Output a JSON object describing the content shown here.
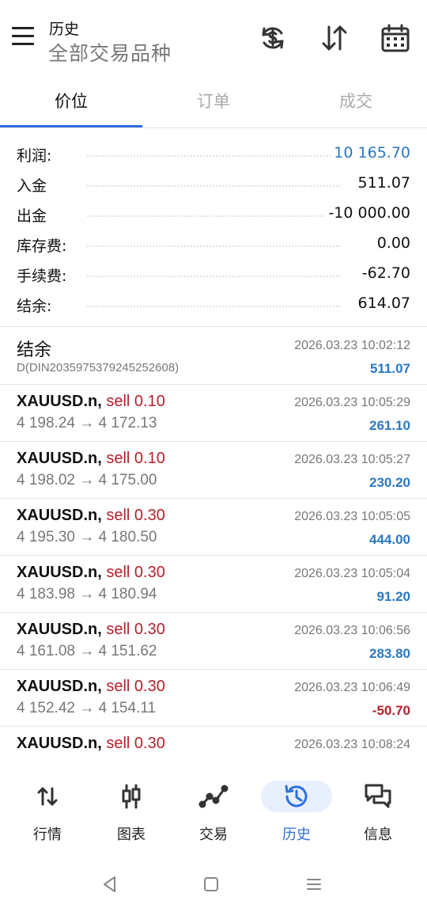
{
  "header": {
    "title": "历史",
    "subtitle": "全部交易品种",
    "icons": [
      "currency-exchange-icon",
      "sort-icon",
      "calendar-icon"
    ]
  },
  "tabs": [
    {
      "label": "价位",
      "active": true
    },
    {
      "label": "订单",
      "active": false
    },
    {
      "label": "成交",
      "active": false
    }
  ],
  "summary": [
    {
      "label": "利润:",
      "value": "10 165.70",
      "color": "#2a78c4"
    },
    {
      "label": "入金",
      "value": "511.07"
    },
    {
      "label": "出金",
      "value": "-10 000.00"
    },
    {
      "label": "库存费:",
      "value": "0.00"
    },
    {
      "label": "手续费:",
      "value": "-62.70"
    },
    {
      "label": "结余:",
      "value": "614.07"
    }
  ],
  "balance_entry": {
    "title": "结余",
    "comment": "D(DIN2035975379245252608)",
    "time": "2026.03.23 10:02:12",
    "amount": "511.07"
  },
  "deals": [
    {
      "symbol": "XAUUSD.n,",
      "type": "sell 0.10",
      "prices": "4 198.24 → 4 172.13",
      "time": "2026.03.23 10:05:29",
      "profit": "261.10"
    },
    {
      "symbol": "XAUUSD.n,",
      "type": "sell 0.10",
      "prices": "4 198.02 → 4 175.00",
      "time": "2026.03.23 10:05:27",
      "profit": "230.20"
    },
    {
      "symbol": "XAUUSD.n,",
      "type": "sell 0.30",
      "prices": "4 195.30 → 4 180.50",
      "time": "2026.03.23 10:05:05",
      "profit": "444.00"
    },
    {
      "symbol": "XAUUSD.n,",
      "type": "sell 0.30",
      "prices": "4 183.98 → 4 180.94",
      "time": "2026.03.23 10:05:04",
      "profit": "91.20"
    },
    {
      "symbol": "XAUUSD.n,",
      "type": "sell 0.30",
      "prices": "4 161.08 → 4 151.62",
      "time": "2026.03.23 10:06:56",
      "profit": "283.80"
    },
    {
      "symbol": "XAUUSD.n,",
      "type": "sell 0.30",
      "prices": "4 152.42 → 4 154.11",
      "time": "2026.03.23 10:06:49",
      "profit": "-50.70"
    },
    {
      "symbol": "XAUUSD.n,",
      "type": "sell 0.30",
      "prices": "",
      "time": "2026.03.23 10:08:24",
      "profit": ""
    }
  ],
  "bottom_nav": [
    {
      "label": "行情",
      "icon": "quotes-arrows-icon",
      "active": false
    },
    {
      "label": "图表",
      "icon": "candlestick-chart-icon",
      "active": false
    },
    {
      "label": "交易",
      "icon": "trade-line-icon",
      "active": false
    },
    {
      "label": "历史",
      "icon": "history-clock-icon",
      "active": true
    },
    {
      "label": "信息",
      "icon": "messages-icon",
      "active": false
    }
  ],
  "system_nav": [
    "back-icon",
    "home-icon",
    "recents-icon"
  ],
  "colors": {
    "accent": "#2f6fe0",
    "profit_positive": "#2a78c4",
    "profit_negative": "#b3212b",
    "sell": "#b3212b"
  }
}
